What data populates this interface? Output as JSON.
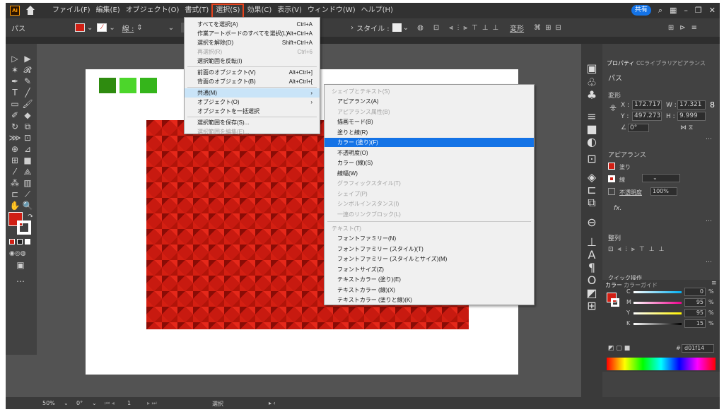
{
  "title_bar": {
    "logo": "Ai",
    "menus": [
      "ファイル(F)",
      "編集(E)",
      "オブジェクト(O)",
      "書式(T)",
      "選択(S)",
      "効果(C)",
      "表示(V)",
      "ウィンドウ(W)",
      "ヘルプ(H)"
    ],
    "active_menu": "選択(S)",
    "share_label": "共有"
  },
  "control_bar": {
    "object_label": "パス",
    "stroke_label": "線 :",
    "style_label": "スタイル :",
    "transform_label": "変形"
  },
  "select_menu": {
    "items": [
      {
        "label": "すべてを選択(A)",
        "shortcut": "Ctrl+A",
        "state": "normal"
      },
      {
        "label": "作業アートボードのすべてを選択(L)",
        "shortcut": "Alt+Ctrl+A",
        "state": "normal"
      },
      {
        "label": "選択を解除(D)",
        "shortcut": "Shift+Ctrl+A",
        "state": "normal"
      },
      {
        "label": "再選択(R)",
        "shortcut": "Ctrl+6",
        "state": "disabled"
      },
      {
        "label": "選択範囲を反転(I)",
        "shortcut": "",
        "state": "normal"
      },
      {
        "label": "前面のオブジェクト(V)",
        "shortcut": "Alt+Ctrl+]",
        "state": "normal"
      },
      {
        "label": "背面のオブジェクト(B)",
        "shortcut": "Alt+Ctrl+[",
        "state": "normal"
      },
      {
        "label": "共通(M)",
        "shortcut": "›",
        "state": "highlight"
      },
      {
        "label": "オブジェクト(O)",
        "shortcut": "›",
        "state": "normal"
      },
      {
        "label": "オブジェクトを一括選択",
        "shortcut": "",
        "state": "normal"
      },
      {
        "label": "選択範囲を保存(S)...",
        "shortcut": "",
        "state": "normal"
      },
      {
        "label": "選択範囲を編集(E)...",
        "shortcut": "",
        "state": "disabled"
      }
    ]
  },
  "common_submenu": {
    "section1": "シェイプとテキスト(S)",
    "items1": [
      {
        "label": "アピアランス(A)",
        "state": "normal"
      },
      {
        "label": "アピアランス属性(B)",
        "state": "disabled"
      },
      {
        "label": "描画モード(B)",
        "state": "normal"
      },
      {
        "label": "塗りと線(R)",
        "state": "normal"
      },
      {
        "label": "カラー (塗り)(F)",
        "state": "selected"
      },
      {
        "label": "不透明度(O)",
        "state": "normal"
      },
      {
        "label": "カラー (線)(S)",
        "state": "normal"
      },
      {
        "label": "線幅(W)",
        "state": "normal"
      },
      {
        "label": "グラフィックスタイル(T)",
        "state": "disabled"
      },
      {
        "label": "シェイプ(P)",
        "state": "disabled"
      },
      {
        "label": "シンボルインスタンス(I)",
        "state": "disabled"
      },
      {
        "label": "一連のリンクブロック(L)",
        "state": "disabled"
      }
    ],
    "section2": "テキスト(T)",
    "items2": [
      {
        "label": "フォントファミリー(N)",
        "state": "normal"
      },
      {
        "label": "フォントファミリー (スタイル)(T)",
        "state": "normal"
      },
      {
        "label": "フォントファミリー (スタイルとサイズ)(M)",
        "state": "normal"
      },
      {
        "label": "フォントサイズ(Z)",
        "state": "normal"
      },
      {
        "label": "テキストカラー (塗り)(E)",
        "state": "normal"
      },
      {
        "label": "テキストカラー (線)(X)",
        "state": "normal"
      },
      {
        "label": "テキストカラー (塗りと線)(K)",
        "state": "normal"
      }
    ]
  },
  "panel": {
    "tabs": [
      "プロパティ",
      "CCライブラリ",
      "アピアランス"
    ],
    "object": "パス",
    "transform_title": "変形",
    "x_label": "X :",
    "x_value": "172.717",
    "y_label": "Y :",
    "y_value": "497.273",
    "w_label": "W :",
    "w_value": "17.321 r",
    "h_label": "H :",
    "h_value": "9.999 m",
    "angle_value": "0°",
    "appearance_title": "アピアランス",
    "fill_label": "塗り",
    "stroke_label": "線",
    "opacity_label": "不透明度",
    "opacity_value": "100%",
    "fx_label": "fx.",
    "align_title": "整列",
    "quick_actions": "クイック操作"
  },
  "color_panel": {
    "tabs": [
      "カラー",
      "カラーガイド"
    ],
    "channels": [
      {
        "label": "C",
        "value": "0",
        "unit": "%"
      },
      {
        "label": "M",
        "value": "95",
        "unit": "%"
      },
      {
        "label": "Y",
        "value": "95",
        "unit": "%"
      },
      {
        "label": "K",
        "value": "15",
        "unit": "%"
      }
    ],
    "hex_value": "d01f14",
    "fill_color": "#d01f14"
  },
  "status_bar": {
    "zoom": "50%",
    "angle": "0°",
    "artboard": "1",
    "tool": "選択"
  },
  "swatches": [
    "#2e8b0f",
    "#4cd62b",
    "#35b51b"
  ],
  "colors": {
    "accent": "#1473e6",
    "highlight_menu": "#e8421c",
    "red_fill": "#d01f14"
  }
}
